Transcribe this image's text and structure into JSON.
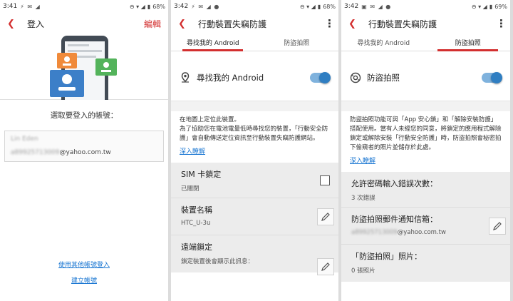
{
  "colors": {
    "accent": "#d32f2f",
    "link": "#1976d2",
    "toggle_on": "#2f7ec2"
  },
  "phone1": {
    "status": {
      "time": "3:41",
      "battery": "68%"
    },
    "appbar": {
      "title": "登入",
      "edit_label": "編輯"
    },
    "prompt": "選取要登入的帳號：",
    "account": {
      "name": "Lin Eden",
      "email_hidden": "a89925713009",
      "email_domain": "@yahoo.com.tw"
    },
    "other_account_link": "使用其他帳號登入",
    "create_account_link": "建立帳號"
  },
  "phone2": {
    "status": {
      "time": "3:42",
      "battery": "68%"
    },
    "appbar": {
      "title": "行動裝置失竊防護"
    },
    "tabs": [
      {
        "label": "尋找我的 Android",
        "active": true
      },
      {
        "label": "防盜拍照",
        "active": false
      }
    ],
    "feature": {
      "label": "尋找我的 Android",
      "icon": "location-icon",
      "enabled": true
    },
    "description": "在地圖上定位此裝置。\n為了協助您在電池電量低時尋找您的裝置，「行動安全防護」會自動傳送定位資訊至行動裝置失竊防護網站。",
    "learn_more": "深入瞭解",
    "settings": [
      {
        "title": "SIM 卡鎖定",
        "subtitle": "已關閉"
      },
      {
        "title": "裝置名稱",
        "subtitle": "HTC_U-3u"
      },
      {
        "title": "遠端鎖定",
        "subtitle": "鎖定裝置後會顯示此訊息："
      }
    ]
  },
  "phone3": {
    "status": {
      "time": "3:42",
      "battery": "69%"
    },
    "appbar": {
      "title": "行動裝置失竊防護"
    },
    "tabs": [
      {
        "label": "尋找我的 Android",
        "active": false
      },
      {
        "label": "防盜拍照",
        "active": true
      }
    ],
    "feature": {
      "label": "防盜拍照",
      "icon": "camera-icon",
      "enabled": true
    },
    "description": "防盜拍照功能可與「App 安心鎖」和「解除安裝防護」搭配使用。當有人未經您的同意，將鎖定的應用程式解除鎖定或解除安裝「行動安全防護」時，防盜拍照會秘密拍下偷窺者的照片並儲存於此處。",
    "learn_more": "深入瞭解",
    "settings": [
      {
        "title": "允許密碼輸入錯誤次數：",
        "subtitle": "3 次錯誤"
      },
      {
        "title": "防盜拍照郵件通知信箱：",
        "subtitle_hidden": "a89925713009",
        "subtitle_domain": "@yahoo.com.tw"
      },
      {
        "title": "「防盜拍照」照片：",
        "subtitle": "0 張照片"
      }
    ]
  }
}
